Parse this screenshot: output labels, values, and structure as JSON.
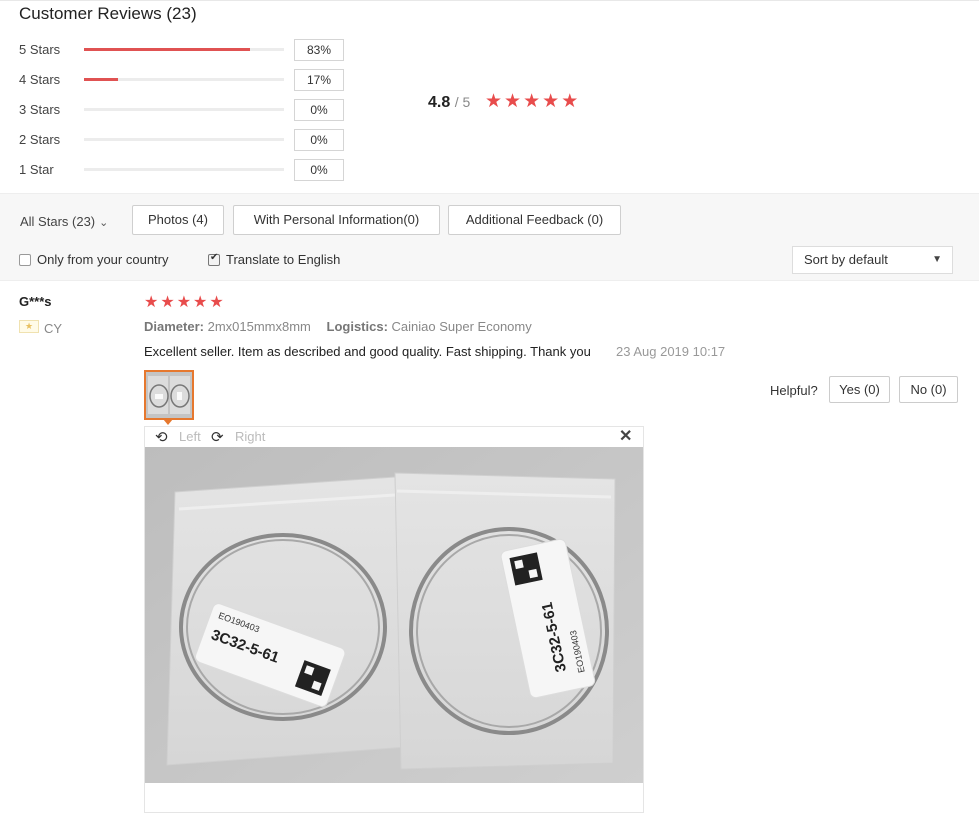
{
  "title": "Customer Reviews (23)",
  "distribution": [
    {
      "label": "5 Stars",
      "percent": "83%",
      "fill": 0.83
    },
    {
      "label": "4 Stars",
      "percent": "17%",
      "fill": 0.17
    },
    {
      "label": "3 Stars",
      "percent": "0%",
      "fill": 0
    },
    {
      "label": "2 Stars",
      "percent": "0%",
      "fill": 0
    },
    {
      "label": "1 Star",
      "percent": "0%",
      "fill": 0
    }
  ],
  "average": {
    "value": "4.8",
    "out_of": "/ 5",
    "stars": 5
  },
  "filters": {
    "all_stars": "All Stars (23)",
    "photos": "Photos (4)",
    "personal": "With Personal Information(0)",
    "additional": "Additional Feedback (0)",
    "only_country": "Only from your country",
    "translate": "Translate to English",
    "sort": "Sort by default"
  },
  "review": {
    "user": "G***s",
    "country": "CY",
    "stars": 5,
    "diameter_label": "Diameter:",
    "diameter_value": "2mx015mmx8mm",
    "logistics_label": "Logistics:",
    "logistics_value": "Cainiao Super Economy",
    "text": "Excellent seller. Item as described and good quality. Fast shipping. Thank you",
    "date": "23 Aug 2019 10:17",
    "helpful_label": "Helpful?",
    "yes_label": "Yes (0)",
    "no_label": "No (0)"
  },
  "viewer": {
    "left_label": "Left",
    "right_label": "Right",
    "close_glyph": "✕",
    "photo": {
      "left_label_code": "3C32-5-61",
      "left_label_lot": "EO190403",
      "right_label_code": "3C32-5-61",
      "right_label_lot": "EO190403"
    }
  },
  "colors": {
    "accent": "#e05252",
    "star": "#e84c4c",
    "thumb_border": "#e6782e"
  }
}
